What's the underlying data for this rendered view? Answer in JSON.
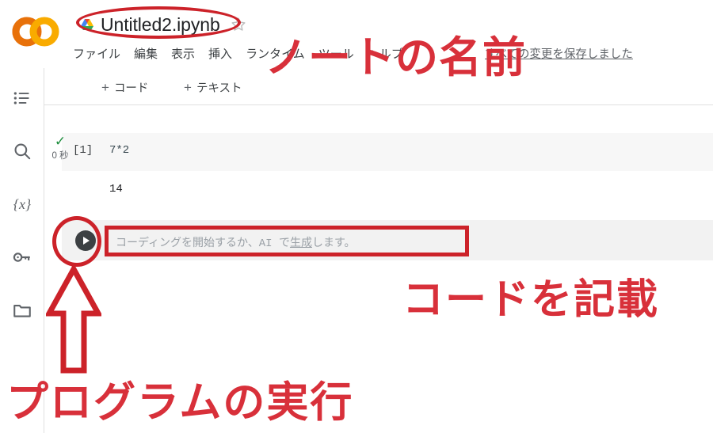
{
  "app": {
    "name": "Google Colaboratory",
    "logo_icon": "colab-logo-icon"
  },
  "header": {
    "drive_icon": "google-drive-icon",
    "notebook_title": "Untitled2.ipynb",
    "star_icon": "star-outline-icon",
    "save_status": "すべての変更を保存しました",
    "menu_items": [
      {
        "label": "ファイル"
      },
      {
        "label": "編集"
      },
      {
        "label": "表示"
      },
      {
        "label": "挿入"
      },
      {
        "label": "ランタイム"
      },
      {
        "label": "ツール"
      },
      {
        "label": "ヘルプ"
      }
    ]
  },
  "sidebar": {
    "items": [
      {
        "name": "table-of-contents",
        "icon": "list-icon"
      },
      {
        "name": "find-and-replace",
        "icon": "search-icon"
      },
      {
        "name": "variables",
        "icon": "variables-braces-icon"
      },
      {
        "name": "secrets",
        "icon": "key-icon"
      },
      {
        "name": "files",
        "icon": "folder-icon"
      }
    ]
  },
  "toolbar": {
    "add_code_label": "コード",
    "add_text_label": "テキスト",
    "plus_glyph": "+"
  },
  "notebook": {
    "cells": [
      {
        "type": "code",
        "status_icon": "green-check-icon",
        "run_time": "0 秒",
        "execution_count": "[1]",
        "source": "7*2",
        "output": "14"
      },
      {
        "type": "code",
        "run_icon": "play-icon",
        "placeholder_prefix": "コーディングを開始するか、AI で",
        "placeholder_link": "生成",
        "placeholder_suffix": "します。"
      }
    ]
  },
  "annotations": {
    "color": "#d8303a",
    "notebook_name_label": "ノートの名前",
    "write_code_label": "コードを記載",
    "run_program_label": "プログラムの実行",
    "title_ellipse": "ellipse-highlight",
    "play_circle": "circle-highlight",
    "prompt_rectangle": "rectangle-highlight",
    "arrow": "up-arrow-annotation"
  }
}
